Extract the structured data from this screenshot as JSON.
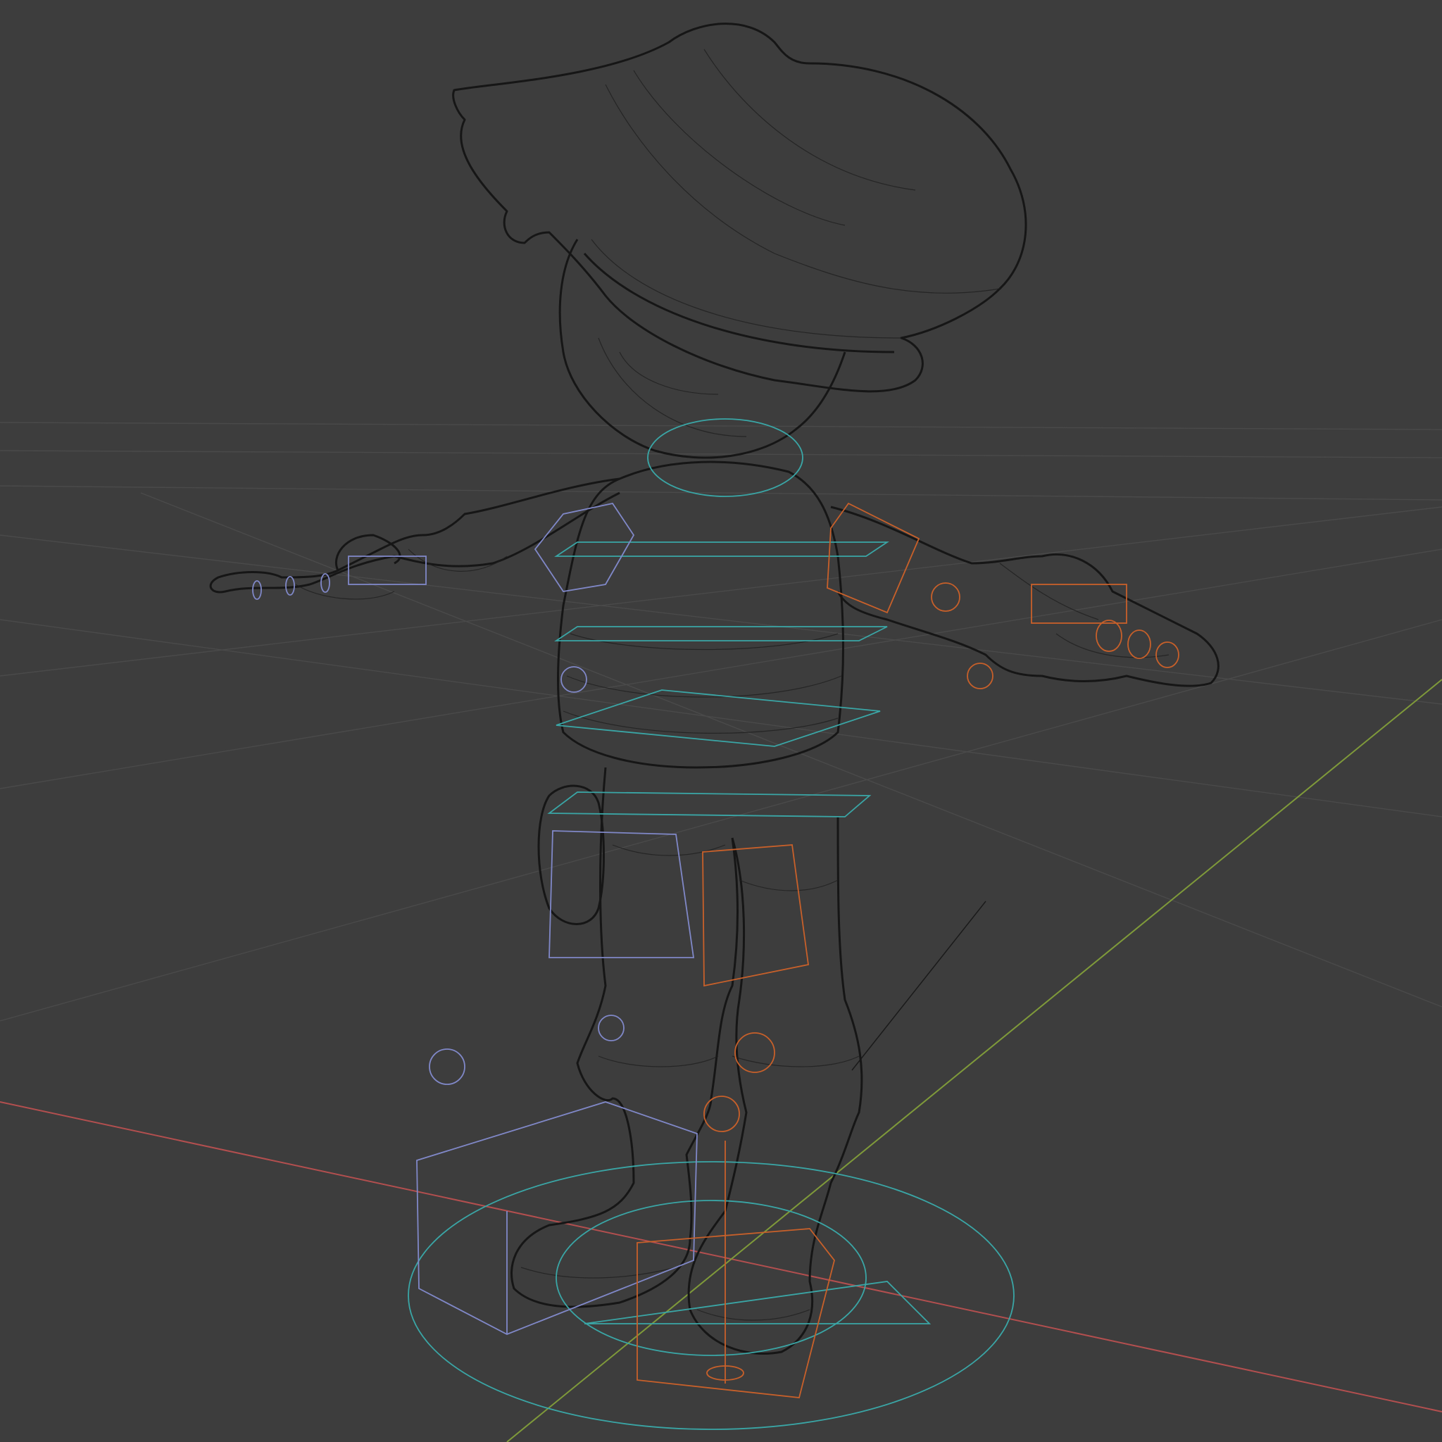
{
  "viewport": {
    "object": "character-rig",
    "shading_mode": "wireframe",
    "show_grid": true
  },
  "colors": {
    "background": "#3d3d3d",
    "grid": "#4a4a4a",
    "axis_x": "#b34f4f",
    "axis_y": "#7f9a3a",
    "mesh_wire": "#161616",
    "control_center": "#3aa6a6",
    "control_left": "#8088c8",
    "control_right": "#c8602a"
  },
  "icons": [
    "floor-grid",
    "x-axis-line",
    "y-axis-line",
    "wireframe-mesh",
    "rig-controls"
  ]
}
